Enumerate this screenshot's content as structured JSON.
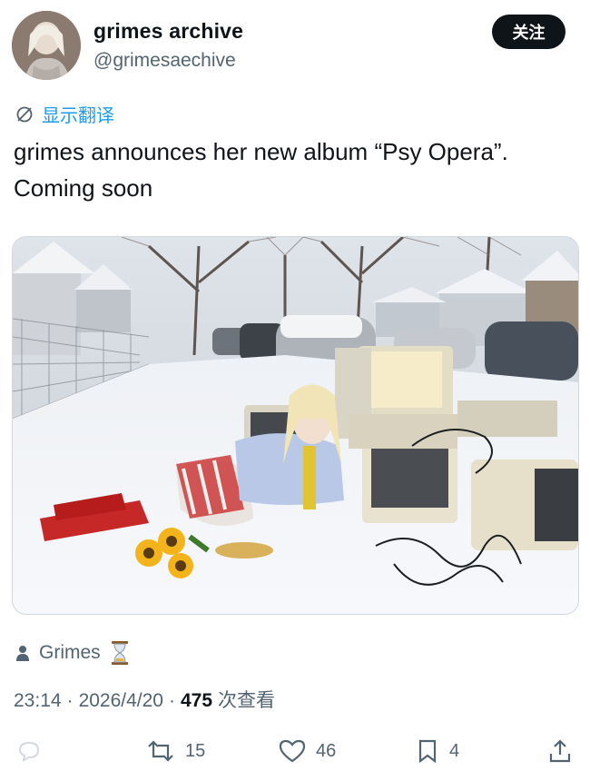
{
  "author": {
    "name": "grimes archive",
    "handle": "@grimesaechive",
    "follow_label": "关注"
  },
  "translate_label": "显示翻译",
  "tweet": {
    "text_line1": "grimes announces her new album “Psy Opera”.",
    "text_line2": "Coming soon"
  },
  "media": {
    "description_icon": "photo"
  },
  "credit": {
    "name": "Grimes",
    "emoji_icon": "hourglass-icon"
  },
  "meta": {
    "time": "23:14",
    "date": "2026/4/20",
    "views_count": "475",
    "views_label": "次查看",
    "separator": "·"
  },
  "actions": {
    "retweets": "15",
    "likes": "46",
    "bookmarks": "4"
  },
  "colors": {
    "accent": "#1d9bf0",
    "secondary_text": "#536471",
    "primary_text": "#0f1419"
  }
}
